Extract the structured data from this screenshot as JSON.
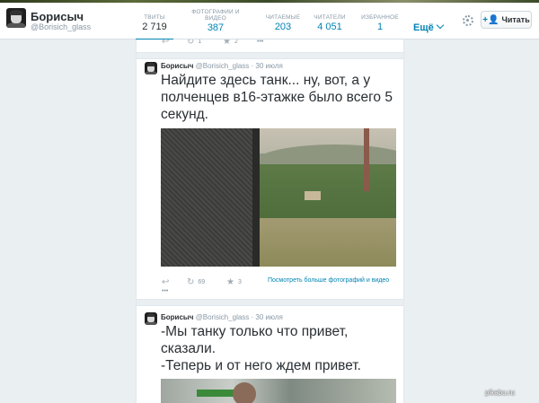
{
  "profile": {
    "name": "Борисыч",
    "handle": "@Borisich_glass"
  },
  "stats": [
    {
      "label": "ТВИТЫ",
      "value": "2 719"
    },
    {
      "label": "ФОТОГРАФИИ И ВИДЕО",
      "value": "387"
    },
    {
      "label": "ЧИТАЕМЫЕ",
      "value": "203"
    },
    {
      "label": "ЧИТАТЕЛИ",
      "value": "4 051"
    },
    {
      "label": "ИЗБРАННОЕ",
      "value": "1"
    }
  ],
  "header": {
    "more_label": "Ещё",
    "follow_label": "Читать"
  },
  "top_actions": {
    "retweets": "1",
    "favorites": "2",
    "more": "•••"
  },
  "tweets": [
    {
      "name": "Борисыч",
      "handle": "@Borisich_glass",
      "date": "· 30 июля",
      "text_lines": [
        "Найдите здесь танк... ну, вот, а у",
        "полченцев в16-этажке было всего 5",
        "секунд."
      ],
      "retweets": "69",
      "favorites": "3",
      "media_link": "Посмотреть больше фотографий и видео",
      "more": "•••"
    },
    {
      "name": "Борисыч",
      "handle": "@Borisich_glass",
      "date": "· 30 июля",
      "text_lines": [
        "-Мы танку только что привет,",
        "сказали.",
        "-Теперь и от него ждем привет."
      ]
    }
  ],
  "watermark": "pikabu.ru"
}
